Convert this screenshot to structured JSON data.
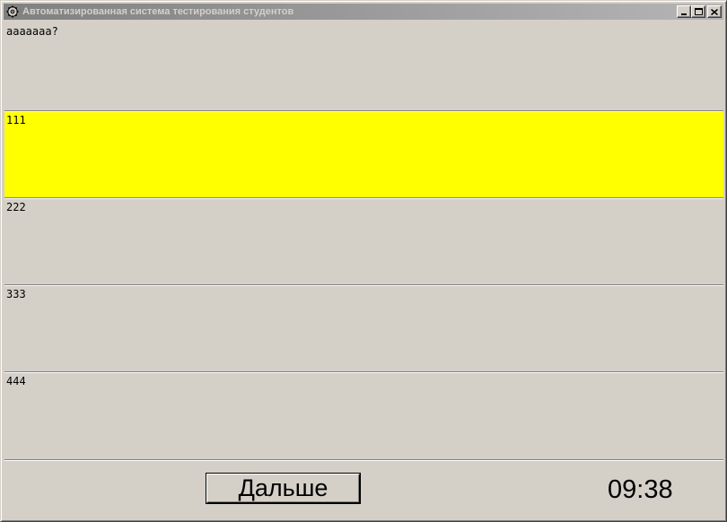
{
  "window": {
    "title": "Автоматизированная система тестирования студентов",
    "icon": "gear-icon"
  },
  "question": {
    "text": "aaaaaaa?"
  },
  "answers": [
    {
      "label": "111",
      "selected": true
    },
    {
      "label": "222",
      "selected": false
    },
    {
      "label": "333",
      "selected": false
    },
    {
      "label": "444",
      "selected": false
    }
  ],
  "footer": {
    "next_label": "Дальше",
    "timer": "09:38"
  },
  "colors": {
    "selected_answer": "#ffff00",
    "face": "#d4d0c8"
  }
}
